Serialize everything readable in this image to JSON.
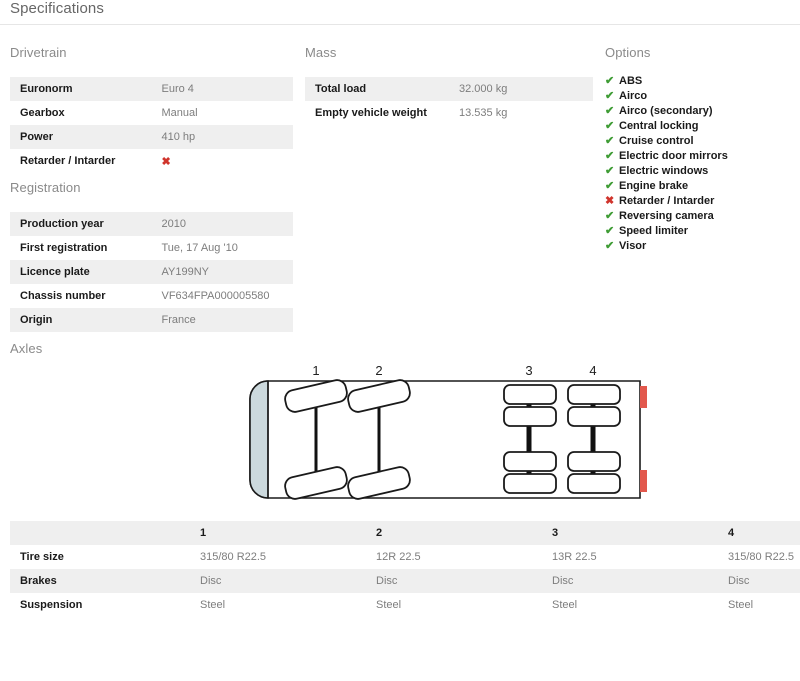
{
  "header": {
    "title": "Specifications"
  },
  "sections": {
    "drivetrain": {
      "heading": "Drivetrain"
    },
    "registration": {
      "heading": "Registration"
    },
    "mass": {
      "heading": "Mass"
    },
    "options": {
      "heading": "Options"
    },
    "axles": {
      "heading": "Axles"
    }
  },
  "drivetrain_rows": [
    {
      "label": "Euronorm",
      "value": "Euro 4",
      "type": "text"
    },
    {
      "label": "Gearbox",
      "value": "Manual",
      "type": "text"
    },
    {
      "label": "Power",
      "value": "410 hp",
      "type": "text"
    },
    {
      "label": "Retarder / Intarder",
      "value": "✖",
      "type": "icon-no"
    }
  ],
  "registration_rows": [
    {
      "label": "Production year",
      "value": "2010",
      "type": "text"
    },
    {
      "label": "First registration",
      "value": "Tue, 17 Aug '10",
      "type": "text"
    },
    {
      "label": "Licence plate",
      "value": "AY199NY",
      "type": "text"
    },
    {
      "label": "Chassis number",
      "value": "VF634FPA000005580",
      "type": "text"
    },
    {
      "label": "Origin",
      "value": "France",
      "type": "text"
    }
  ],
  "mass_rows": [
    {
      "label": "Total load",
      "value": "32.000 kg",
      "type": "text"
    },
    {
      "label": "Empty vehicle weight",
      "value": "13.535 kg",
      "type": "text"
    }
  ],
  "options_items": [
    {
      "label": "ABS",
      "available": true,
      "icon": "check-icon",
      "glyph": "✔"
    },
    {
      "label": "Airco",
      "available": true,
      "icon": "check-icon",
      "glyph": "✔"
    },
    {
      "label": "Airco (secondary)",
      "available": true,
      "icon": "check-icon",
      "glyph": "✔"
    },
    {
      "label": "Central locking",
      "available": true,
      "icon": "check-icon",
      "glyph": "✔"
    },
    {
      "label": "Cruise control",
      "available": true,
      "icon": "check-icon",
      "glyph": "✔"
    },
    {
      "label": "Electric door mirrors",
      "available": true,
      "icon": "check-icon",
      "glyph": "✔"
    },
    {
      "label": "Electric windows",
      "available": true,
      "icon": "check-icon",
      "glyph": "✔"
    },
    {
      "label": "Engine brake",
      "available": true,
      "icon": "check-icon",
      "glyph": "✔"
    },
    {
      "label": "Retarder / Intarder",
      "available": false,
      "icon": "cross-icon",
      "glyph": "✖"
    },
    {
      "label": "Reversing camera",
      "available": true,
      "icon": "check-icon",
      "glyph": "✔"
    },
    {
      "label": "Speed limiter",
      "available": true,
      "icon": "check-icon",
      "glyph": "✔"
    },
    {
      "label": "Visor",
      "available": true,
      "icon": "check-icon",
      "glyph": "✔"
    }
  ],
  "axle_diagram": {
    "labels": [
      "1",
      "2",
      "3",
      "4"
    ],
    "axles": [
      {
        "number": "1",
        "kind": "steered-single"
      },
      {
        "number": "2",
        "kind": "steered-single"
      },
      {
        "number": "3",
        "kind": "twin"
      },
      {
        "number": "4",
        "kind": "twin"
      }
    ],
    "colors": {
      "body_outline": "#1a1a1a",
      "windshield": "#ccd9dd",
      "taillight": "#e2584d",
      "axle_shaft": "#111111"
    }
  },
  "axle_table": {
    "columns": [
      "",
      "1",
      "2",
      "3",
      "4"
    ],
    "rows": [
      {
        "label": "Tire size",
        "values": [
          "315/80 R22.5",
          "12R 22.5",
          "13R 22.5",
          "315/80 R22.5"
        ]
      },
      {
        "label": "Brakes",
        "values": [
          "Disc",
          "Disc",
          "Disc",
          "Disc"
        ]
      },
      {
        "label": "Suspension",
        "values": [
          "Steel",
          "Steel",
          "Steel",
          "Steel"
        ]
      }
    ]
  },
  "theme": {
    "row_alt_bg": "#efefef",
    "label_color": "#1a1a1a",
    "value_color": "#7d7d7d",
    "heading_color": "#8a8a8a",
    "check_green": "#3f9c35",
    "cross_red": "#d0342c"
  }
}
